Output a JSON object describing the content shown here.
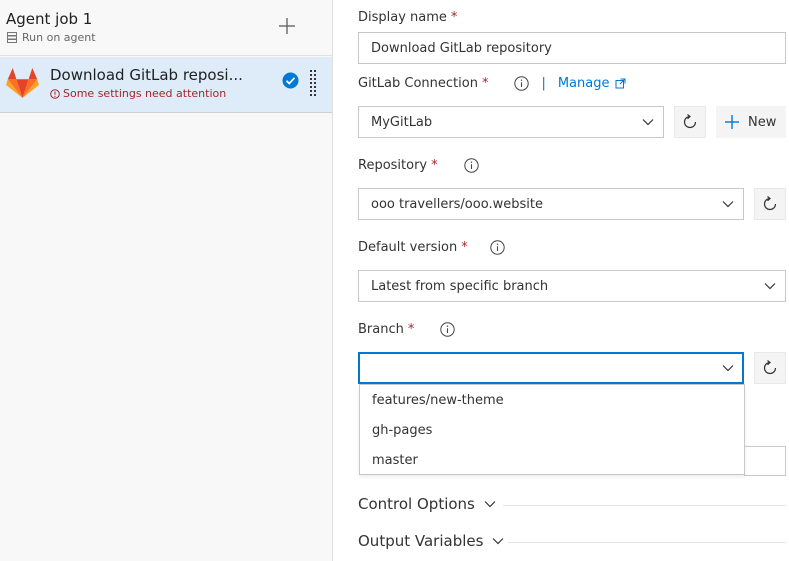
{
  "left": {
    "agent_job": {
      "title": "Agent job 1",
      "subtitle": "Run on agent"
    },
    "task": {
      "title": "Download GitLab reposi...",
      "warning": "Some settings need attention"
    }
  },
  "form": {
    "display_name": {
      "label": "Display name",
      "required": "*",
      "value": "Download GitLab repository"
    },
    "connection": {
      "label": "GitLab Connection",
      "required": "*",
      "manage_label": "Manage",
      "value": "MyGitLab",
      "new_label": "New"
    },
    "repository": {
      "label": "Repository",
      "required": "*",
      "value": "ooo travellers/ooo.website"
    },
    "default_version": {
      "label": "Default version",
      "required": "*",
      "value": "Latest from specific branch"
    },
    "branch": {
      "label": "Branch",
      "required": "*",
      "value": "",
      "options": [
        "features/new-theme",
        "gh-pages",
        "master"
      ]
    }
  },
  "sections": {
    "control_options": "Control Options",
    "output_variables": "Output Variables"
  },
  "colors": {
    "accent": "#0078d4",
    "selected_bg": "#deecf9",
    "error": "#a4262c",
    "gitlab_orange": "#e24329"
  }
}
